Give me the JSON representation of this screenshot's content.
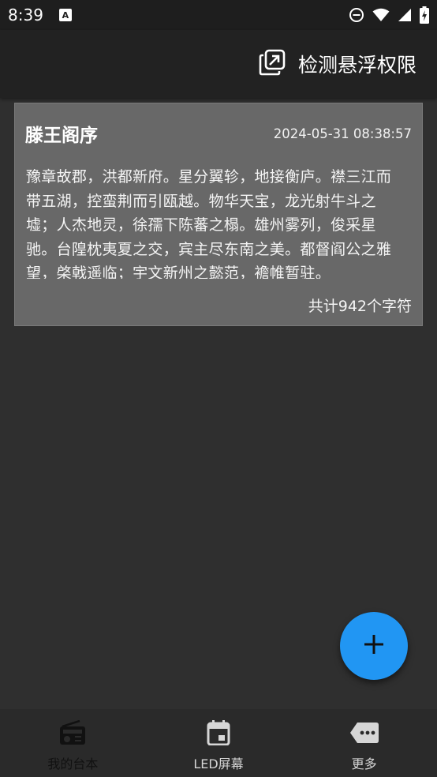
{
  "status_bar": {
    "time": "8:39",
    "app_icon_letter": "A"
  },
  "app_bar": {
    "action_label": "检测悬浮权限",
    "action_icon": "open-in-new-icon"
  },
  "card": {
    "title": "滕王阁序",
    "date": "2024-05-31 08:38:57",
    "body": "豫章故郡，洪都新府。星分翼轸，地接衡庐。襟三江而带五湖，控蛮荆而引瓯越。物华天宝，龙光射牛斗之墟；人杰地灵，徐孺下陈蕃之榻。雄州雾列，俊采星驰。台隍枕夷夏之交，宾主尽东南之美。都督阎公之雅望，棨戟遥临；宇文新州之懿范，襜帷暂驻。",
    "char_count": "共计942个字符"
  },
  "fab": {
    "icon": "plus-icon"
  },
  "bottom_nav": {
    "items": [
      {
        "label": "我的台本",
        "icon": "radio-icon",
        "active": true
      },
      {
        "label": "LED屏幕",
        "icon": "calendar-icon",
        "active": false
      },
      {
        "label": "更多",
        "icon": "more-tag-icon",
        "active": false
      }
    ]
  },
  "colors": {
    "accent": "#2196f3",
    "background": "#2f2f2f",
    "card": "#686868",
    "app_bar": "#222222"
  }
}
